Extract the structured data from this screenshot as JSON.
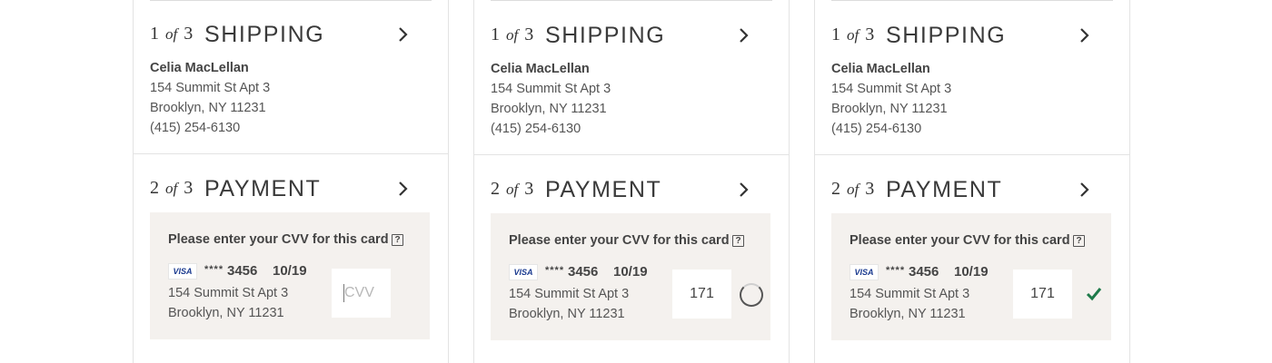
{
  "steps": {
    "shipping": {
      "number": "1",
      "of": "of",
      "total": "3",
      "title": "SHIPPING"
    },
    "payment": {
      "number": "2",
      "of": "of",
      "total": "3",
      "title": "PAYMENT"
    }
  },
  "address": {
    "name": "Celia MacLellan",
    "line1": "154 Summit St Apt 3",
    "line2": "Brooklyn, NY 11231",
    "phone": "(415) 254-6130"
  },
  "cvv_prompt": "Please enter your CVV for this card",
  "help_symbol": "?",
  "card": {
    "brand": "VISA",
    "masked": "****",
    "last4": "3456",
    "expiry": "10/19",
    "line1": "154 Summit St Apt 3",
    "line2": "Brooklyn, NY 11231"
  },
  "cvv_field": {
    "placeholder": "CVV",
    "entered_value": "171"
  },
  "colors": {
    "success": "#1e7a4a",
    "box_bg": "#f4f1ee"
  },
  "icons": [
    "chevron-right-icon",
    "help-icon",
    "visa-logo-icon",
    "loading-spinner-icon",
    "checkmark-icon"
  ]
}
